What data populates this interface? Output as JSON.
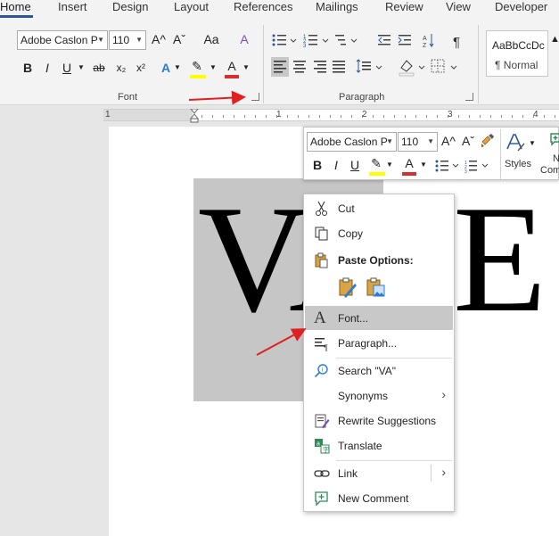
{
  "tabs": [
    {
      "label": "Home",
      "active": true
    },
    {
      "label": "Insert"
    },
    {
      "label": "Design"
    },
    {
      "label": "Layout"
    },
    {
      "label": "References"
    },
    {
      "label": "Mailings"
    },
    {
      "label": "Review"
    },
    {
      "label": "View"
    },
    {
      "label": "Developer"
    }
  ],
  "ribbon": {
    "font_name": "Adobe Caslon P",
    "font_size": "110",
    "font_group_label": "Font",
    "paragraph_group_label": "Paragraph",
    "style_sample": "AaBbCcDc",
    "style_name": "¶ Normal",
    "grow_font_icon": "A^",
    "shrink_font_icon": "Aˇ",
    "change_case_icon": "Aa",
    "clear_format_icon": "A",
    "bold": "B",
    "italic": "I",
    "underline": "U",
    "strike": "ab",
    "subscript": "x₂",
    "superscript": "x²",
    "text_effects_icon": "A",
    "highlight_icon": "✎",
    "font_color_icon": "A",
    "pilcrow": "¶"
  },
  "ruler": {
    "numbers": [
      "1",
      "1",
      "2",
      "3",
      "4"
    ]
  },
  "document": {
    "selected_text": "VA",
    "rest_text": "E"
  },
  "mini_toolbar": {
    "font_name": "Adobe Caslon P",
    "font_size": "110",
    "grow_icon": "A^",
    "shrink_icon": "Aˇ",
    "bold": "B",
    "italic": "I",
    "underline": "U",
    "styles_label": "Styles",
    "new_comment_label_top": "N",
    "new_comment_label_bottom": "Com"
  },
  "context_menu": {
    "items": [
      {
        "label": "Cut",
        "icon": "scissors-icon"
      },
      {
        "label": "Copy",
        "icon": "copy-icon"
      },
      {
        "label": "Paste Options:",
        "icon": "paste-icon"
      },
      {
        "label": "Font...",
        "icon": "font-a-icon",
        "highlighted": true
      },
      {
        "label": "Paragraph...",
        "icon": "paragraph-icon"
      },
      {
        "label": "Search \"VA\"",
        "icon": "search-icon"
      },
      {
        "label": "Synonyms",
        "icon": "",
        "submenu": true
      },
      {
        "label": "Rewrite Suggestions",
        "icon": "rewrite-icon"
      },
      {
        "label": "Translate",
        "icon": "translate-icon"
      },
      {
        "label": "Link",
        "icon": "link-icon",
        "submenu": true
      },
      {
        "label": "New Comment",
        "icon": "new-comment-icon"
      }
    ],
    "paste_options": [
      "paste-keep-source-icon",
      "paste-picture-icon"
    ]
  },
  "colors": {
    "accent": "#2b579a",
    "highlight_yellow": "#ffff00",
    "font_red": "#d62f2f",
    "annotation_arrow": "#e02020",
    "menu_highlight": "#c8c8c8"
  }
}
